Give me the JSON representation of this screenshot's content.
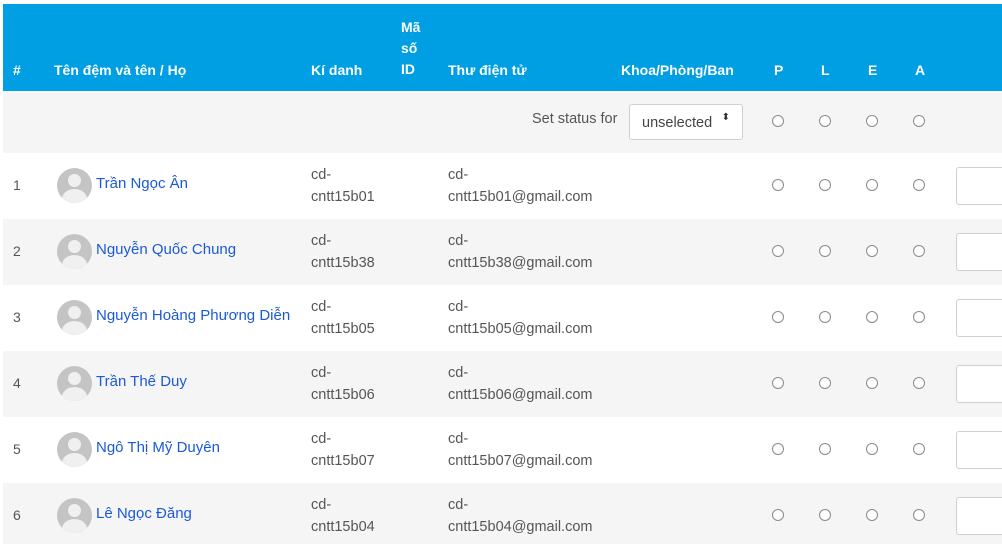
{
  "headers": {
    "num": "#",
    "name": "Tên đệm và tên / Họ",
    "username": "Kí danh",
    "idnumber_line1": "Mã",
    "idnumber_line2": "số",
    "idnumber_line3": "ID",
    "email": "Thư điện tử",
    "department": "Khoa/Phòng/Ban",
    "p": "P",
    "l": "L",
    "e": "E",
    "a": "A"
  },
  "status": {
    "label": "Set status for",
    "selected": "unselected",
    "arrow": "⬍"
  },
  "rows": [
    {
      "num": "1",
      "name": "Trần Ngọc Ân",
      "username_line1": "cd-",
      "username_line2": "cntt15b01",
      "email_line1": "cd-",
      "email_line2": "cntt15b01@gmail.com"
    },
    {
      "num": "2",
      "name": "Nguyễn Quốc Chung",
      "username_line1": "cd-",
      "username_line2": "cntt15b38",
      "email_line1": "cd-",
      "email_line2": "cntt15b38@gmail.com"
    },
    {
      "num": "3",
      "name": "Nguyễn Hoàng Phương Diễn",
      "username_line1": "cd-",
      "username_line2": "cntt15b05",
      "email_line1": "cd-",
      "email_line2": "cntt15b05@gmail.com"
    },
    {
      "num": "4",
      "name": "Trần Thế Duy",
      "username_line1": "cd-",
      "username_line2": "cntt15b06",
      "email_line1": "cd-",
      "email_line2": "cntt15b06@gmail.com"
    },
    {
      "num": "5",
      "name": "Ngô Thị Mỹ Duyên",
      "username_line1": "cd-",
      "username_line2": "cntt15b07",
      "email_line1": "cd-",
      "email_line2": "cntt15b07@gmail.com"
    },
    {
      "num": "6",
      "name": "Lê Ngọc Đăng",
      "username_line1": "cd-",
      "username_line2": "cntt15b04",
      "email_line1": "cd-",
      "email_line2": "cntt15b04@gmail.com"
    }
  ],
  "colors": {
    "header_bg": "#009ee3",
    "link": "#1a5ad8",
    "alt_row": "#f5f5f5"
  }
}
